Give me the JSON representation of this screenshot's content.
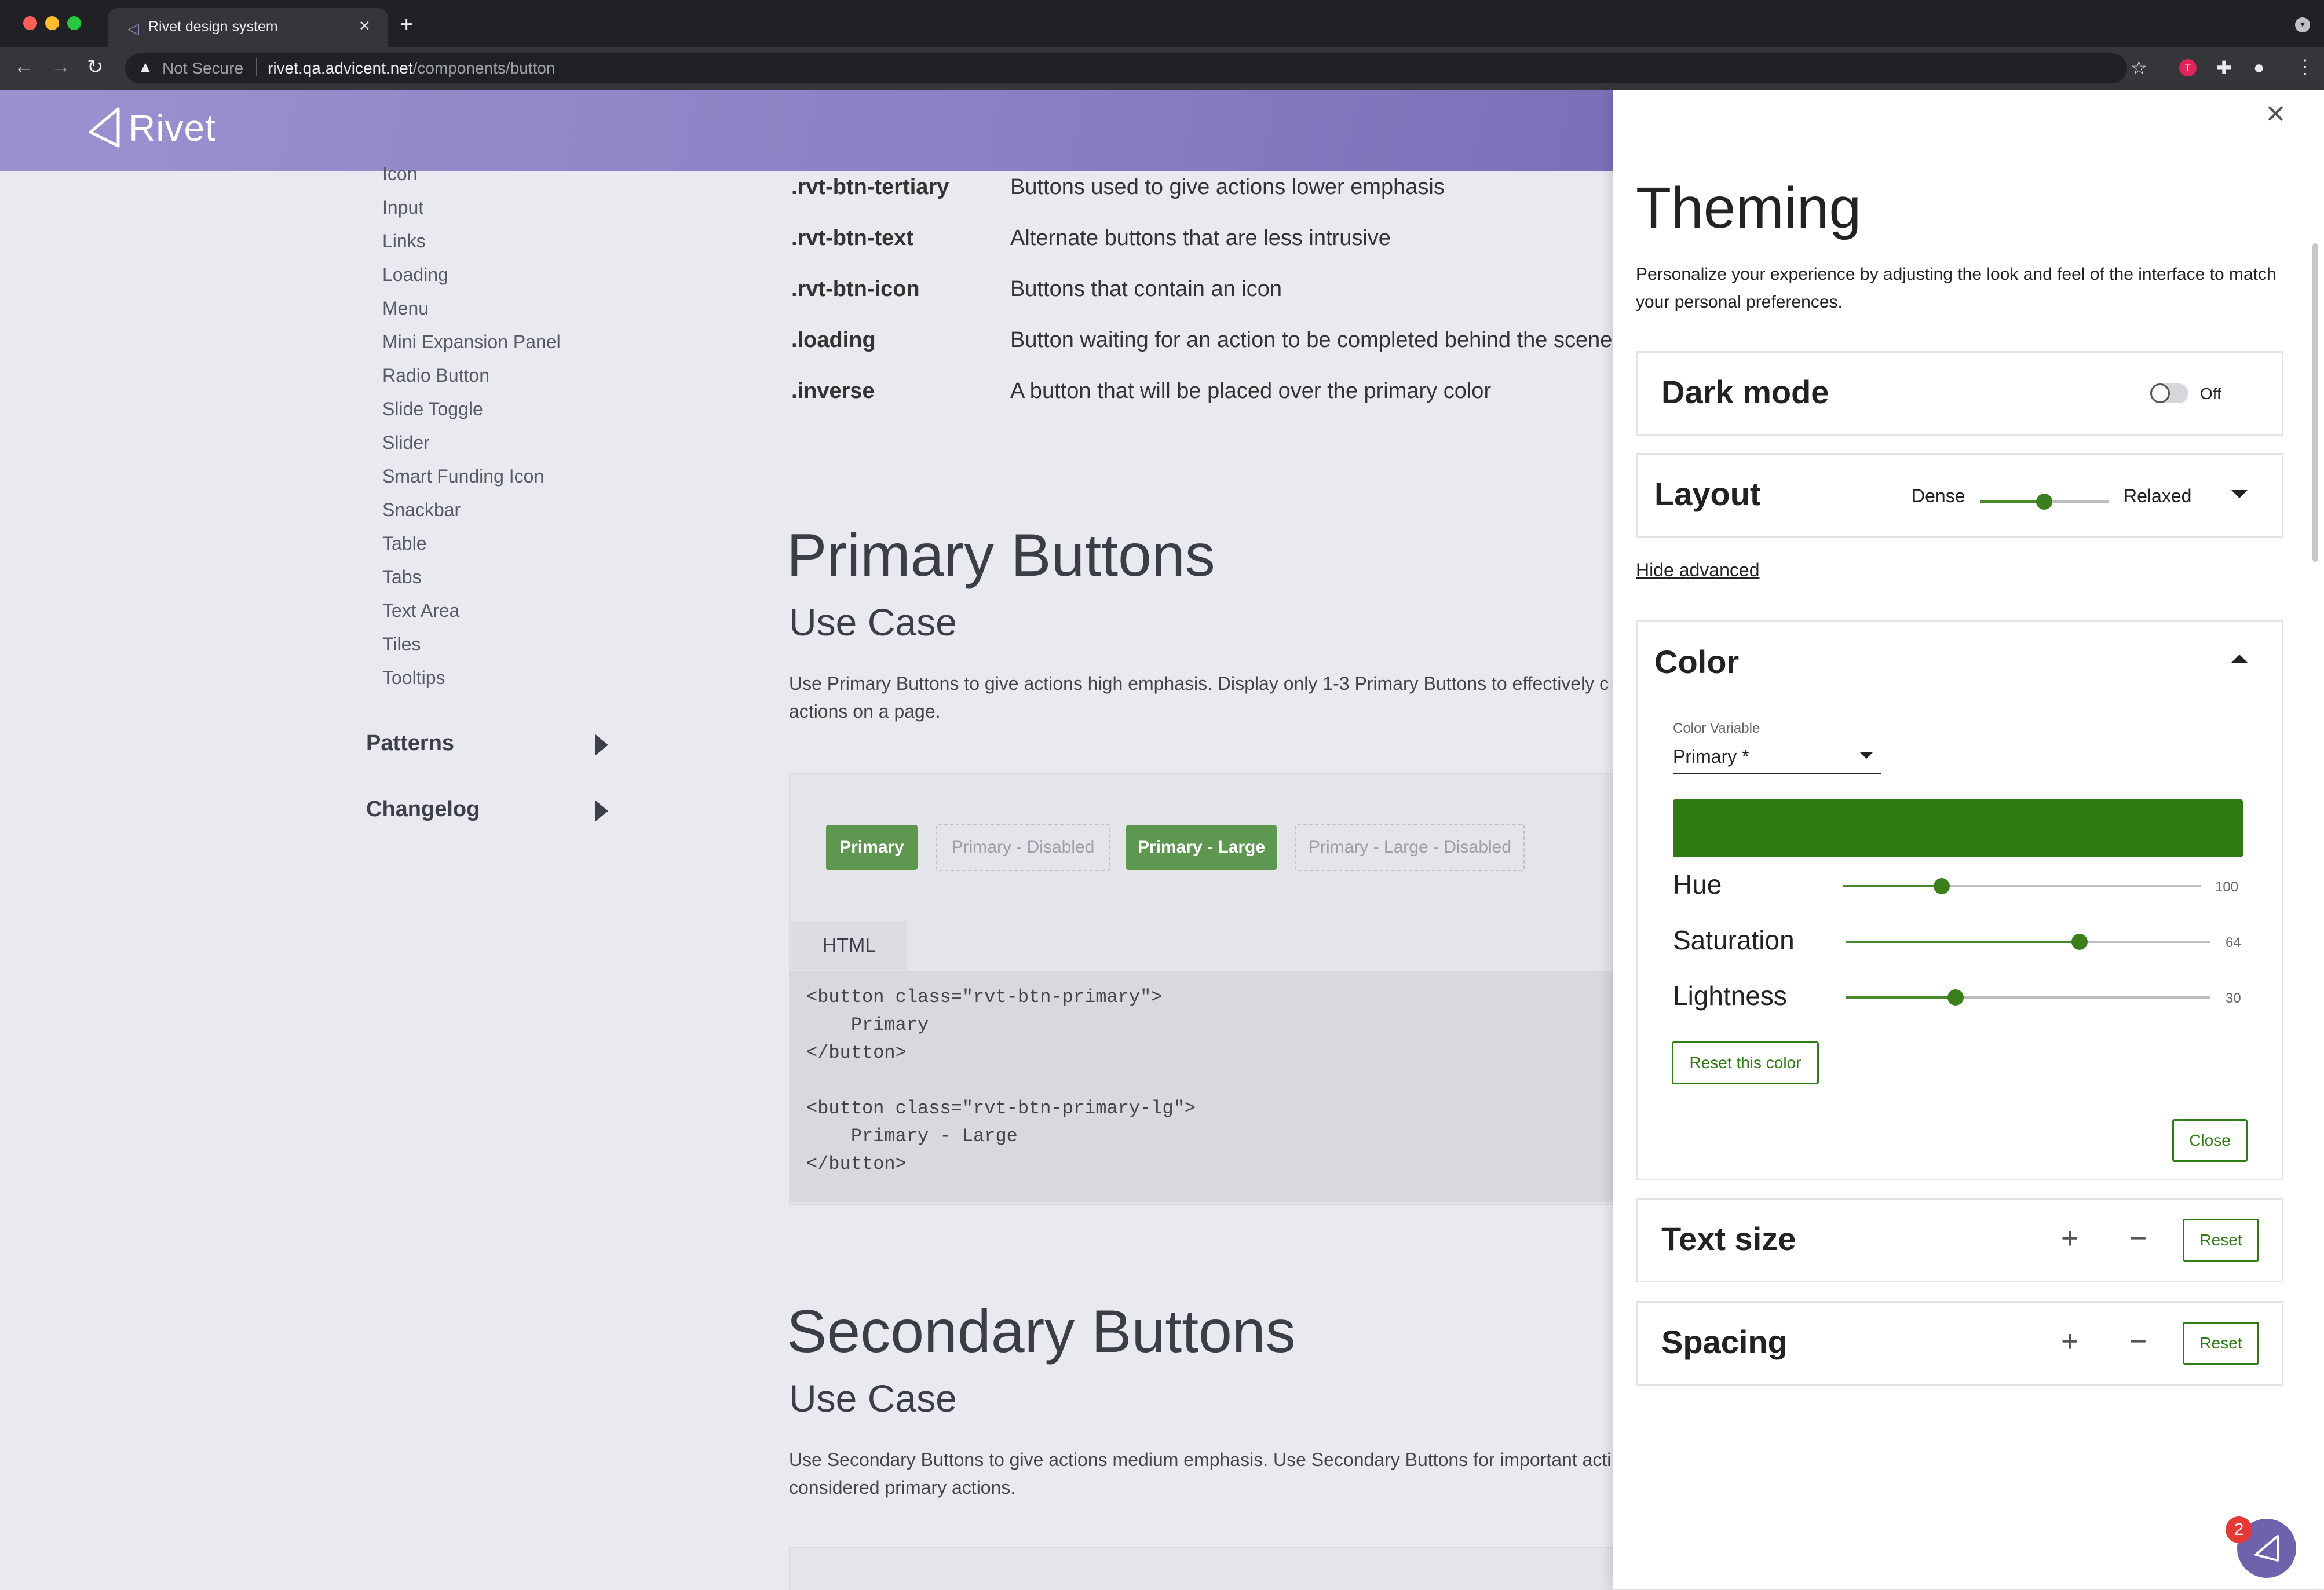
{
  "browser": {
    "tab_title": "Rivet design system",
    "tab_close": "×",
    "new_tab": "+",
    "security_label": "Not Secure",
    "url_host": "rivet.qa.advicent.net",
    "url_path": "/components/button"
  },
  "header": {
    "logo_text": "Rivet"
  },
  "sidebar": {
    "items": [
      "Icon",
      "Input",
      "Links",
      "Loading",
      "Menu",
      "Mini Expansion Panel",
      "Radio Button",
      "Slide Toggle",
      "Slider",
      "Smart Funding Icon",
      "Snackbar",
      "Table",
      "Tabs",
      "Text Area",
      "Tiles",
      "Tooltips"
    ],
    "groups": [
      "Patterns",
      "Changelog"
    ]
  },
  "classes": [
    {
      "name": ".rvt-btn-tertiary",
      "desc": "Buttons used to give actions lower emphasis"
    },
    {
      "name": ".rvt-btn-text",
      "desc": "Alternate buttons that are less intrusive"
    },
    {
      "name": ".rvt-btn-icon",
      "desc": "Buttons that contain an icon"
    },
    {
      "name": ".loading",
      "desc": "Button waiting for an action to be completed behind the scene"
    },
    {
      "name": ".inverse",
      "desc": "A button that will be placed over the primary color"
    }
  ],
  "primary": {
    "title": "Primary Buttons",
    "subtitle": "Use Case",
    "text": "Use Primary Buttons to give actions high emphasis. Display only 1-3 Primary Buttons to effectively c actions on a page.",
    "buttons": [
      "Primary",
      "Primary - Disabled",
      "Primary - Large",
      "Primary - Large - Disabled"
    ],
    "code_tab": "HTML",
    "code": "<button class=\"rvt-btn-primary\">\n    Primary\n</button>\n\n<button class=\"rvt-btn-primary-lg\">\n    Primary - Large\n</button>"
  },
  "secondary": {
    "title": "Secondary Buttons",
    "subtitle": "Use Case",
    "text": "Use Secondary Buttons to give actions medium emphasis. Use Secondary Buttons for important acti considered primary actions."
  },
  "theming": {
    "title": "Theming",
    "subtitle": "Personalize your experience by adjusting the look and feel of the interface to match your personal preferences.",
    "dark_mode": {
      "label": "Dark mode",
      "state": "Off"
    },
    "layout": {
      "label": "Layout",
      "min_label": "Dense",
      "max_label": "Relaxed",
      "value": 0.5
    },
    "hide_advanced": "Hide advanced",
    "color": {
      "label": "Color",
      "variable_label": "Color Variable",
      "variable_value": "Primary *",
      "swatch": "#2f7a12",
      "sliders": [
        {
          "label": "Hue",
          "value": "100"
        },
        {
          "label": "Saturation",
          "value": "64"
        },
        {
          "label": "Lightness",
          "value": "30"
        }
      ],
      "reset": "Reset this color",
      "close": "Close"
    },
    "text_size": {
      "label": "Text size",
      "plus": "+",
      "minus": "−",
      "reset": "Reset"
    },
    "spacing": {
      "label": "Spacing",
      "plus": "+",
      "minus": "−",
      "reset": "Reset"
    }
  },
  "fab": {
    "badge": "2"
  },
  "colors": {
    "accent": "#2e7d14",
    "header": "#8a80c4",
    "primary_button": "#5e9850"
  }
}
